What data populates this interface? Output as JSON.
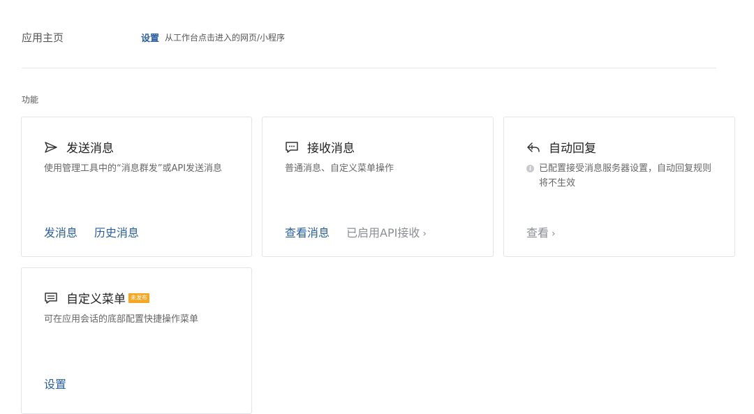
{
  "home": {
    "label": "应用主页",
    "link": "设置",
    "desc": "从工作台点击进入的网页/小程序"
  },
  "section_title": "功能",
  "cards": [
    {
      "title": "发送消息",
      "icon": "send-icon",
      "desc": "使用管理工具中的“消息群发”或API发送消息",
      "actions": [
        "发消息",
        "历史消息"
      ]
    },
    {
      "title": "接收消息",
      "icon": "chat-bubble-icon",
      "desc": "普通消息、自定义菜单操作",
      "actions": [
        "查看消息",
        "已启用API接收"
      ]
    },
    {
      "title": "自动回复",
      "icon": "reply-icon",
      "desc": "已配置接受消息服务器设置，自动回复规则将不生效",
      "info_glyph": "i",
      "actions": [
        "查看"
      ]
    },
    {
      "title": "自定义菜单",
      "icon": "menu-icon",
      "badge": "未发布",
      "desc": "可在应用会话的底部配置快捷操作菜单",
      "actions": [
        "设置"
      ]
    }
  ],
  "colors": {
    "link": "#2a5f9e",
    "badge": "#f5a623",
    "muted": "#8a8e94"
  },
  "chevron": "›"
}
